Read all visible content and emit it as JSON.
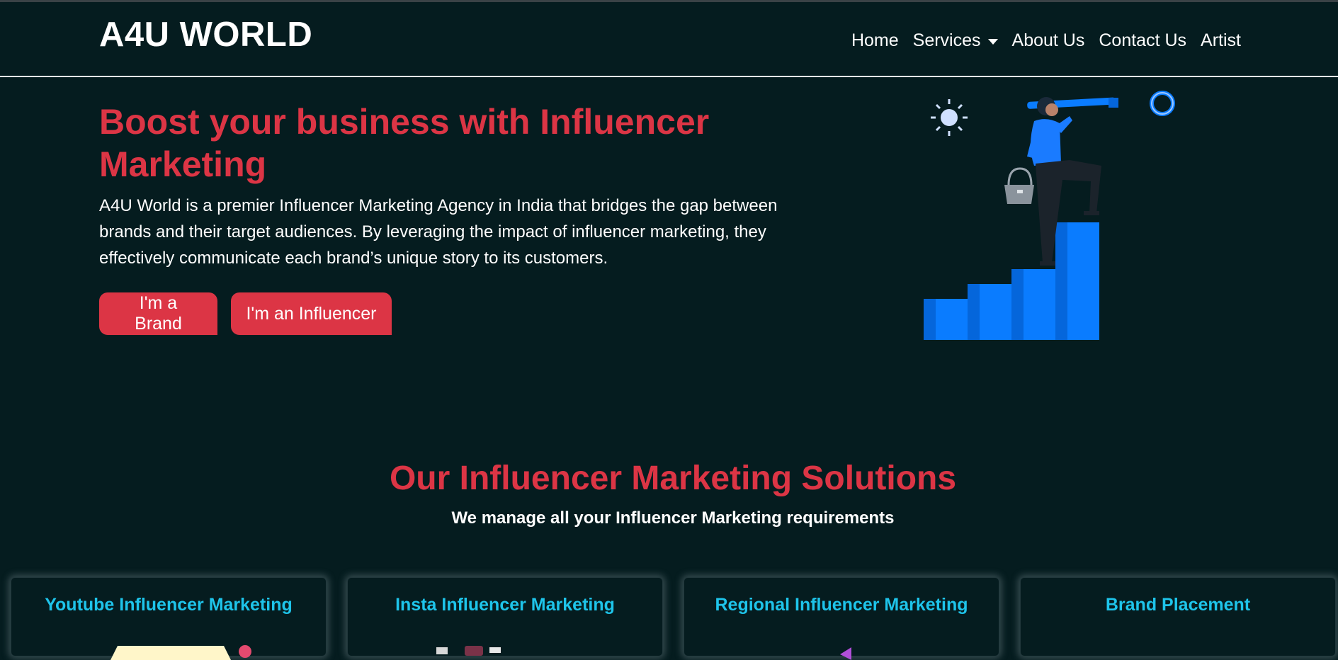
{
  "navbar": {
    "brand": "A4U WORLD",
    "links": [
      {
        "label": "Home"
      },
      {
        "label": "Services",
        "has_dropdown": true
      },
      {
        "label": "About Us"
      },
      {
        "label": "Contact Us"
      },
      {
        "label": "Artist"
      }
    ]
  },
  "hero": {
    "title": "Boost your business with Influencer Marketing",
    "description": "A4U World is a premier Influencer Marketing Agency in India that bridges the gap between brands and their target audiences. By leveraging the impact of influencer marketing, they effectively communicate each brand’s unique story to its customers.",
    "buttons": {
      "brand": "I'm a Brand",
      "influencer": "I'm an Influencer"
    },
    "illustration_icons": [
      "person-with-telescope-icon",
      "sun-icon",
      "ring-icon",
      "handbag-icon"
    ]
  },
  "solutions": {
    "title": "Our Influencer Marketing Solutions",
    "subtitle": "We manage all your Influencer Marketing requirements",
    "cards": [
      {
        "title": "Youtube Influencer Marketing"
      },
      {
        "title": "Insta Influencer Marketing"
      },
      {
        "title": "Regional Influencer Marketing"
      },
      {
        "title": "Brand Placement"
      }
    ]
  },
  "colors": {
    "background": "#051c1f",
    "accent_red": "#dc3545",
    "card_title": "#1ec4ea",
    "stairs_blue": "#0a7cff"
  }
}
